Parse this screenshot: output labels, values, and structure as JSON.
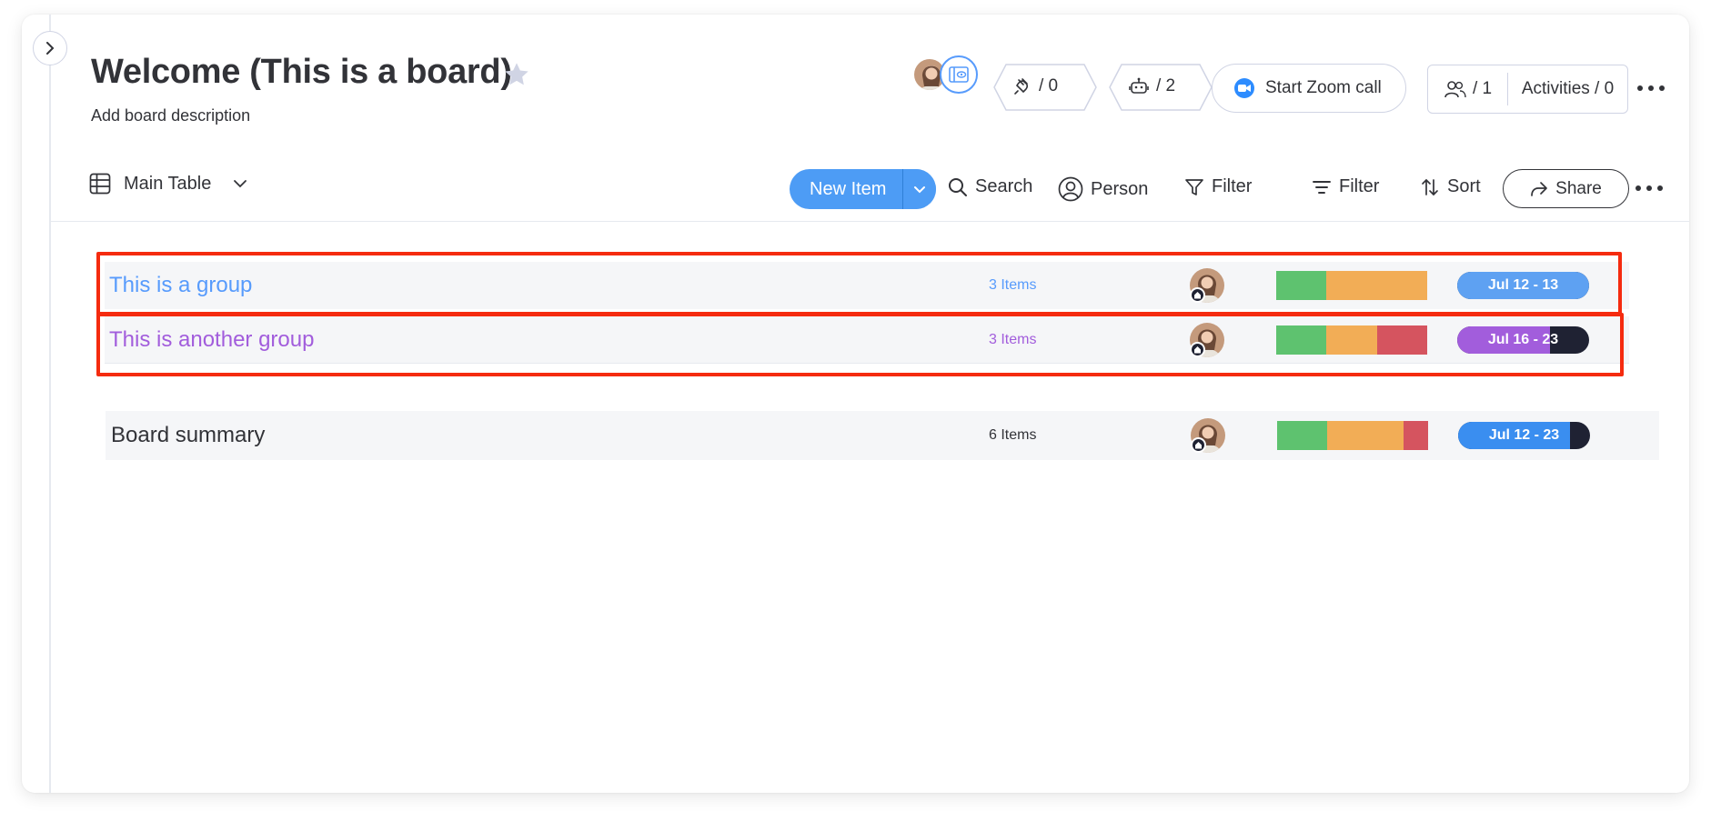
{
  "board": {
    "title": "Welcome (This is a board)",
    "description": "Add board description"
  },
  "header": {
    "integrations_count": "/ 0",
    "automations_count": "/ 2",
    "zoom_label": "Start Zoom call",
    "members_count": "/ 1",
    "activities_label": "Activities / 0"
  },
  "toolbar": {
    "view_label": "Main Table",
    "new_item_label": "New Item",
    "search_label": "Search",
    "person_label": "Person",
    "filter_label": "Filter",
    "filter2_label": "Filter",
    "sort_label": "Sort",
    "share_label": "Share"
  },
  "groups": [
    {
      "name": "This is a group",
      "count": "3 Items",
      "color": "#579bfc",
      "status_segments": [
        {
          "color": "#5ec26f",
          "fraction": 0.333
        },
        {
          "color": "#f2ad56",
          "fraction": 0.667
        }
      ],
      "timeline_label": "Jul 12 - 13",
      "timeline_color": "#5ea1f2",
      "timeline_progress": 1.0
    },
    {
      "name": "This is another group",
      "count": "3 Items",
      "color": "#a25ddc",
      "status_segments": [
        {
          "color": "#5ec26f",
          "fraction": 0.333
        },
        {
          "color": "#f2ad56",
          "fraction": 0.333
        },
        {
          "color": "#d5545f",
          "fraction": 0.334
        }
      ],
      "timeline_label": "Jul 16 - 23",
      "timeline_color": "#a25ddc",
      "timeline_progress": 0.75
    }
  ],
  "summary": {
    "name": "Board summary",
    "count": "6 Items",
    "status_segments": [
      {
        "color": "#5ec26f",
        "fraction": 0.333
      },
      {
        "color": "#f2ad56",
        "fraction": 0.5
      },
      {
        "color": "#d5545f",
        "fraction": 0.167
      }
    ],
    "timeline_label": "Jul 12 - 23",
    "timeline_color": "#3a8ef0",
    "timeline_progress": 0.85
  },
  "colors": {
    "primary": "#4d9cf5",
    "highlight": "#f52b0f"
  }
}
